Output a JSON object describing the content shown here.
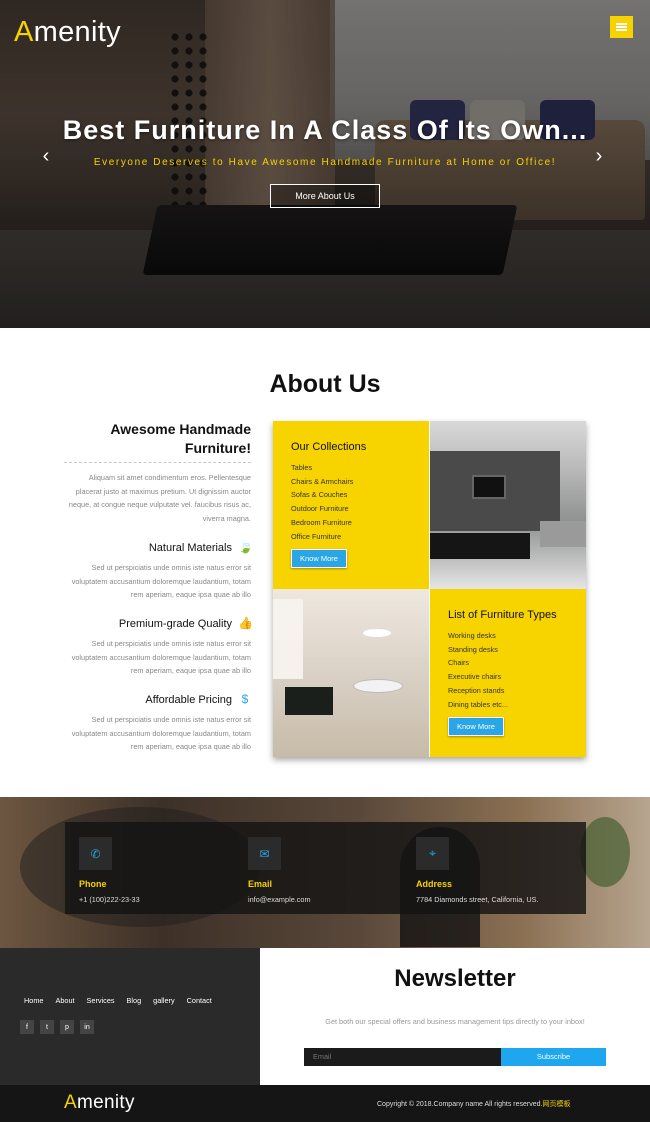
{
  "brand": {
    "first_letter": "A",
    "rest": "menity"
  },
  "hero": {
    "title": "Best Furniture In A Class Of Its Own...",
    "subtitle": "Everyone Deserves to Have Awesome Handmade Furniture at Home or Office!",
    "button": "More About Us",
    "prev_icon": "chevron-left-icon",
    "next_icon": "chevron-right-icon",
    "menu_icon": "hamburger-icon"
  },
  "about": {
    "title": "About Us",
    "lead_title": "Awesome Handmade Furniture!",
    "lead_text": "Aliquam sit amet condimentum eros. Pellentesque placerat justo at maximus pretium. Ut dignissim auctor neque, at congue neque vulputate vel. faucibus risus ac, viverra magna.",
    "features": [
      {
        "title": "Natural Materials",
        "icon": "leaf-icon",
        "glyph": "🍃",
        "text": "Sed ut perspiciatis unde omnis iste natus error sit voluptatem accusantium doloremque laudantium, totam rem aperiam, eaque ipsa quae ab illo"
      },
      {
        "title": "Premium-grade Quality",
        "icon": "thumbs-up-icon",
        "glyph": "👍",
        "text": "Sed ut perspiciatis unde omnis iste natus error sit voluptatem accusantium doloremque laudantium, totam rem aperiam, eaque ipsa quae ab illo"
      },
      {
        "title": "Affordable Pricing",
        "icon": "dollar-icon",
        "glyph": "$",
        "text": "Sed ut perspiciatis unde omnis iste natus error sit voluptatem accusantium doloremque laudantium, totam rem aperiam, eaque ipsa quae ab illo"
      }
    ],
    "collections": {
      "title": "Our Collections",
      "items": [
        "Tables",
        "Chairs & Armchairs",
        "Sofas & Couches",
        "Outdoor Furniture",
        "Bedroom Furniture",
        "Office Furniture"
      ],
      "button": "Know More"
    },
    "types": {
      "title": "List of Furniture Types",
      "items": [
        "Working desks",
        "Standing desks",
        "Chairs",
        "Executive chairs",
        "Reception stands",
        "Dining tables etc..."
      ],
      "button": "Know More"
    }
  },
  "contact": {
    "phone": {
      "label": "Phone",
      "value": "+1 (100)222-23-33",
      "icon": "phone-icon",
      "glyph": "✆"
    },
    "email": {
      "label": "Email",
      "value": "info@example.com",
      "icon": "envelope-icon",
      "glyph": "✉"
    },
    "address": {
      "label": "Address",
      "value": "7784 Diamonds street, California, US.",
      "icon": "map-marker-icon",
      "glyph": "⌖"
    }
  },
  "footer": {
    "nav": [
      "Home",
      "About",
      "Services",
      "Blog",
      "gallery",
      "Contact"
    ],
    "socials": [
      {
        "icon": "facebook-icon",
        "glyph": "f"
      },
      {
        "icon": "twitter-icon",
        "glyph": "t"
      },
      {
        "icon": "pinterest-icon",
        "glyph": "p"
      },
      {
        "icon": "linkedin-icon",
        "glyph": "in"
      }
    ],
    "newsletter_title": "Newsletter",
    "newsletter_text": "Get both our special offers and business management tips directly to your inbox!",
    "email_placeholder": "Email",
    "subscribe": "Subscribe",
    "copyright": "Copyright © 2018.Company name All rights reserved.",
    "copyright_link": "网页模板"
  },
  "colors": {
    "accent": "#f5d200",
    "blue": "#2aa5e6",
    "dark": "#2a2a2a"
  }
}
